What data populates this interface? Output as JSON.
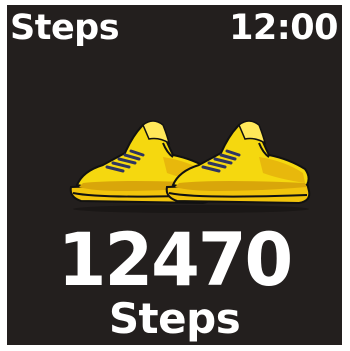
{
  "header": {
    "title": "Steps",
    "time": "12:00"
  },
  "main": {
    "step_count": "12470",
    "unit_label": "Steps",
    "illustration": "sneakers-icon"
  },
  "colors": {
    "background": "#231f1e",
    "text": "#ffffff",
    "shoe_primary": "#f5d80f",
    "shoe_shadow": "#d9a60a",
    "shoe_sole": "#f2c40c",
    "shoe_laces": "#2f3560"
  }
}
